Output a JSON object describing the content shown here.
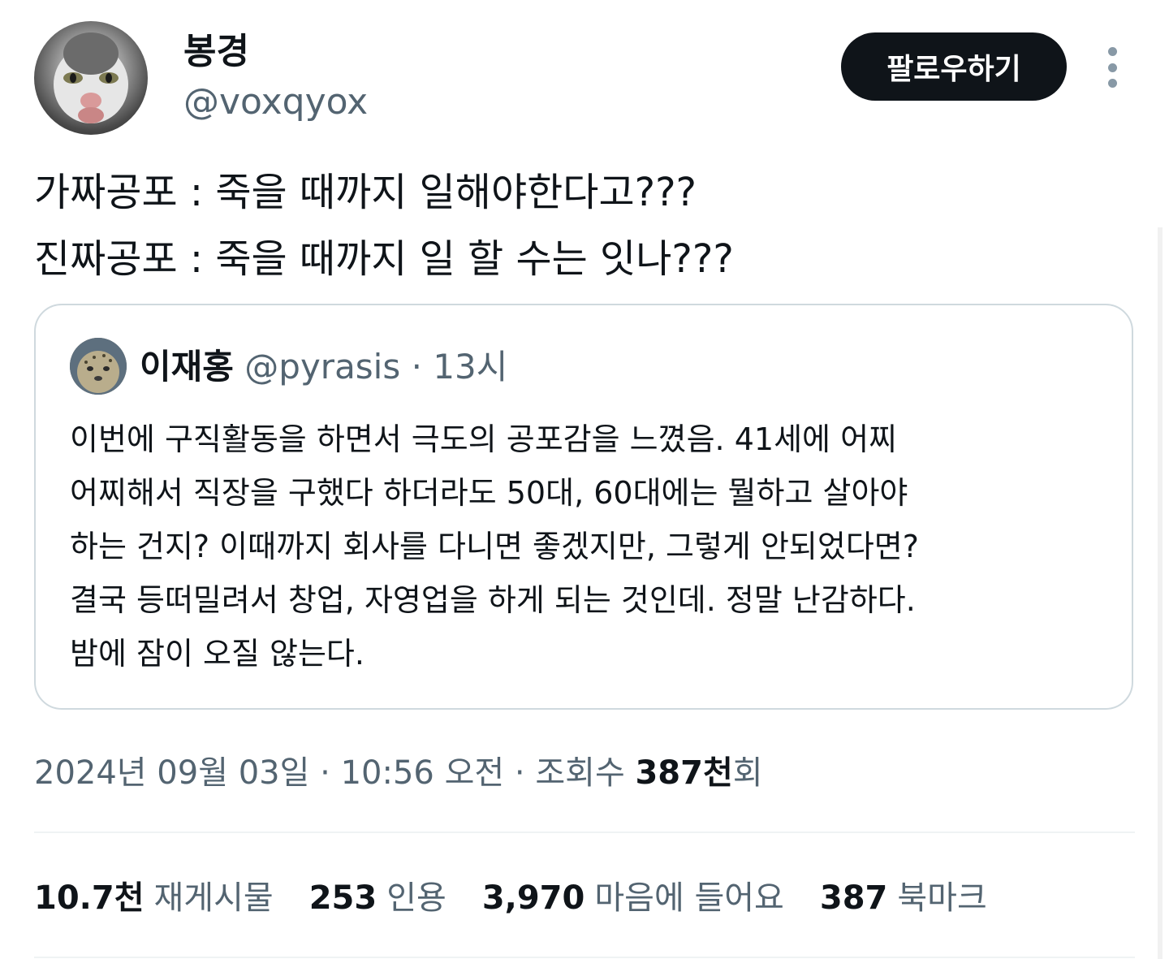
{
  "author": {
    "display_name": "봉경",
    "handle": "@voxqyox",
    "avatar_icon": "cat-avatar"
  },
  "follow_button": {
    "label": "팔로우하기"
  },
  "more_menu": {
    "icon": "more-vertical-icon"
  },
  "tweet": {
    "lines": [
      "가짜공포 : 죽을 때까지 일해야한다고???",
      "진짜공포 : 죽을 때까지 일 할 수는 잇나???"
    ]
  },
  "quoted_tweet": {
    "author_name": "이재홍",
    "handle": "@pyrasis",
    "separator": "·",
    "time": "13시",
    "avatar_icon": "cheetah-cub-avatar",
    "lines": [
      "이번에 구직활동을 하면서 극도의 공포감을 느꼈음. 41세에 어찌",
      "어찌해서 직장을 구했다 하더라도 50대, 60대에는 뭘하고 살아야",
      "하는 건지? 이때까지 회사를 다니면 좋겠지만, 그렇게 안되었다면?",
      "결국 등떠밀려서 창업, 자영업을 하게 되는 것인데. 정말 난감하다.",
      "밤에 잠이 오질 않는다."
    ]
  },
  "meta": {
    "date": "2024년 09월 03일",
    "separator": "·",
    "time": "10:56 오전",
    "views_label": "조회수",
    "views_count": "387천",
    "views_suffix": "회"
  },
  "stats": [
    {
      "count": "10.7천",
      "label": "재게시물"
    },
    {
      "count": "253",
      "label": "인용"
    },
    {
      "count": "3,970",
      "label": "마음에 들어요"
    },
    {
      "count": "387",
      "label": "북마크"
    }
  ],
  "colors": {
    "text_primary": "#0f1419",
    "text_secondary": "#536471",
    "border": "#cfd9de",
    "button_bg": "#0f1419"
  }
}
